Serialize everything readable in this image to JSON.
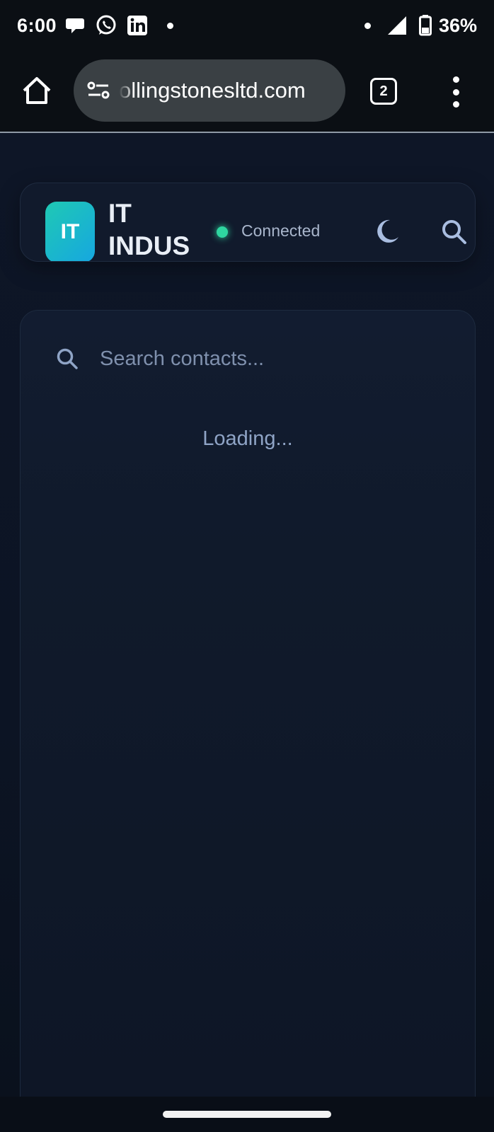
{
  "status_bar": {
    "time": "6:00",
    "battery": "36%",
    "notification_icons": [
      "chat-bubble-icon",
      "whatsapp-icon",
      "linkedin-icon"
    ]
  },
  "browser": {
    "url": "ollingstonesltd.com",
    "tab_count": "2"
  },
  "header": {
    "logo_text": "IT",
    "brand_line1": "IT",
    "brand_line2": "INDUS",
    "connection_status": "Connected",
    "status_color": "#2fd6a0"
  },
  "contacts": {
    "search_placeholder": "Search contacts...",
    "loading_text": "Loading..."
  },
  "colors": {
    "accent_gradient_start": "#1fc9b4",
    "accent_gradient_end": "#16a7e0",
    "page_background": "#0b1220"
  }
}
